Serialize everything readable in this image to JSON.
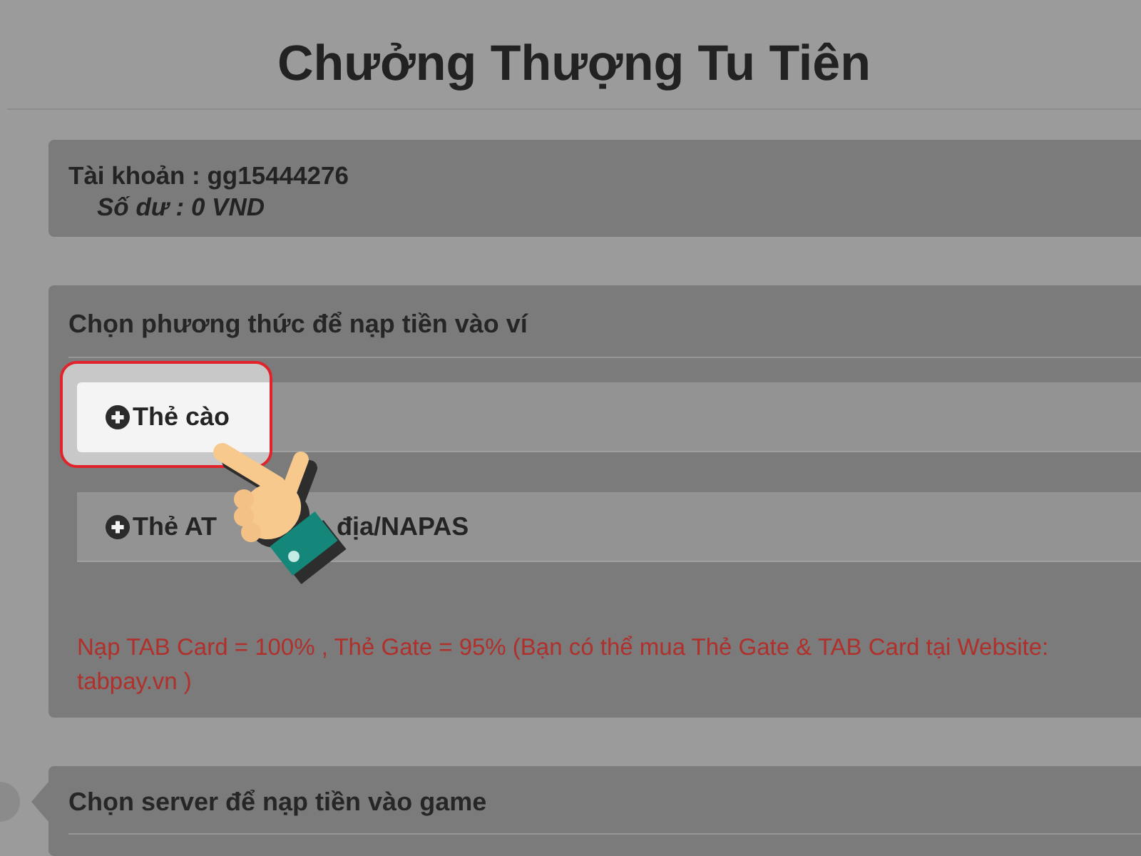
{
  "page": {
    "title": "Chưởng Thượng Tu Tiên"
  },
  "account_panel": {
    "account": "Tài khoản : gg15444276",
    "balance": "Số dư : 0 VND"
  },
  "payment_panel": {
    "heading": "Chọn phương thức để nạp tiền vào ví",
    "options": [
      {
        "label": "Thẻ cào",
        "highlighted": true
      },
      {
        "label": "Thẻ AT",
        "label_continued": "địa/NAPAS",
        "highlighted": false
      }
    ],
    "notice": "Nạp TAB Card = 100% , Thẻ Gate = 95% (Bạn có thể mua Thẻ Gate & TAB Card tại Website: tabpay.vn )"
  },
  "server_panel": {
    "heading": "Chọn server để nạp tiền vào game"
  }
}
